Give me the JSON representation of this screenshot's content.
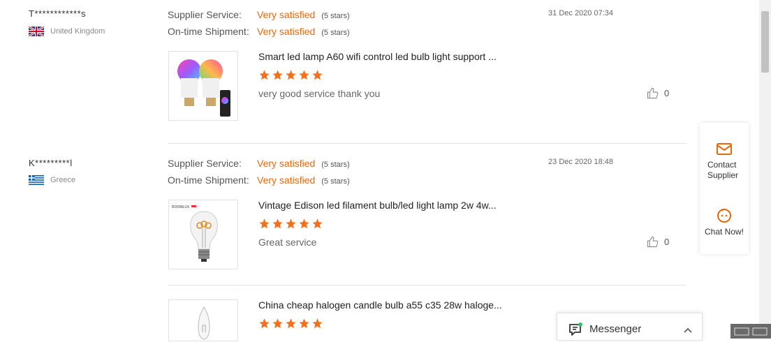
{
  "reviews": [
    {
      "user": "T************s",
      "country": "United Kingdom",
      "supplier_label": "Supplier Service:",
      "supplier_value": "Very satisfied",
      "supplier_stars": "(5 stars)",
      "shipment_label": "On-time Shipment:",
      "shipment_value": "Very satisfied",
      "shipment_stars": "(5 stars)",
      "date": "31 Dec 2020 07:34",
      "product_title": "Smart led lamp A60 wifi control led bulb light support ...",
      "rating": 5,
      "comment": "very good service thank you",
      "likes": "0"
    },
    {
      "user": "K*********l",
      "country": "Greece",
      "supplier_label": "Supplier Service:",
      "supplier_value": "Very satisfied",
      "supplier_stars": "(5 stars)",
      "shipment_label": "On-time Shipment:",
      "shipment_value": "Very satisfied",
      "shipment_stars": "(5 stars)",
      "date": "23 Dec 2020 18:48",
      "product_title": "Vintage Edison led filament bulb/led light lamp 2w 4w...",
      "rating": 5,
      "comment": "Great service",
      "likes": "0"
    },
    {
      "product_title": "China cheap halogen candle bulb a55 c35 28w haloge...",
      "rating": 5
    }
  ],
  "side_panel": {
    "contact_label": "Contact Supplier",
    "chat_label": "Chat Now!"
  },
  "messenger": {
    "label": "Messenger"
  },
  "colors": {
    "accent": "#e6690a",
    "star": "#f5701a"
  }
}
